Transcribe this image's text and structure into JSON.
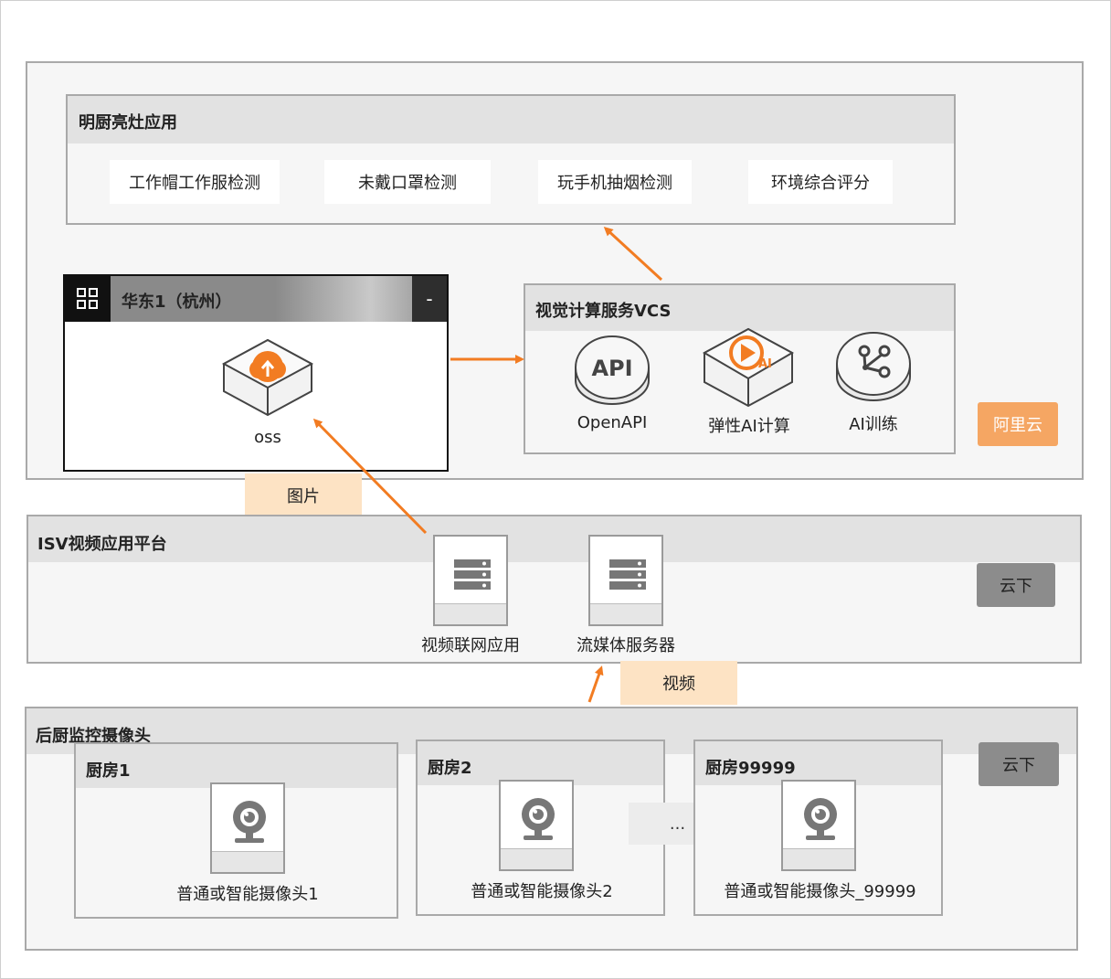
{
  "cloud": {
    "tag": "阿里云",
    "app": {
      "title": "明厨亮灶应用",
      "features": [
        "工作帽工作服检测",
        "未戴口罩检测",
        "玩手机抽烟检测",
        "环境综合评分"
      ]
    },
    "region": {
      "title": "华东1（杭州）",
      "collapse_label": "-",
      "oss_label": "oss"
    },
    "vcs": {
      "title": "视觉计算服务VCS",
      "api_icon_text": "API",
      "ai_icon_text": "AI",
      "services": [
        "OpenAPI",
        "弹性AI计算",
        "AI训练"
      ]
    },
    "image_tag": "图片"
  },
  "isv": {
    "title": "ISV视频应用平台",
    "tag": "云下",
    "servers": [
      "视频联网应用",
      "流媒体服务器"
    ],
    "video_tag": "视频"
  },
  "kitchen": {
    "title": "后厨监控摄像头",
    "tag": "云下",
    "ellipsis": "...",
    "rooms": [
      {
        "title": "厨房1",
        "camera": "普通或智能摄像头1"
      },
      {
        "title": "厨房2",
        "camera": "普通或智能摄像头2"
      },
      {
        "title": "厨房99999",
        "camera": "普通或智能摄像头_99999"
      }
    ]
  },
  "colors": {
    "accent": "#f27c22",
    "cloud_tag": "#f5a663",
    "offcloud_tag": "#8c8c8c",
    "label_tag": "#fde3c4"
  }
}
